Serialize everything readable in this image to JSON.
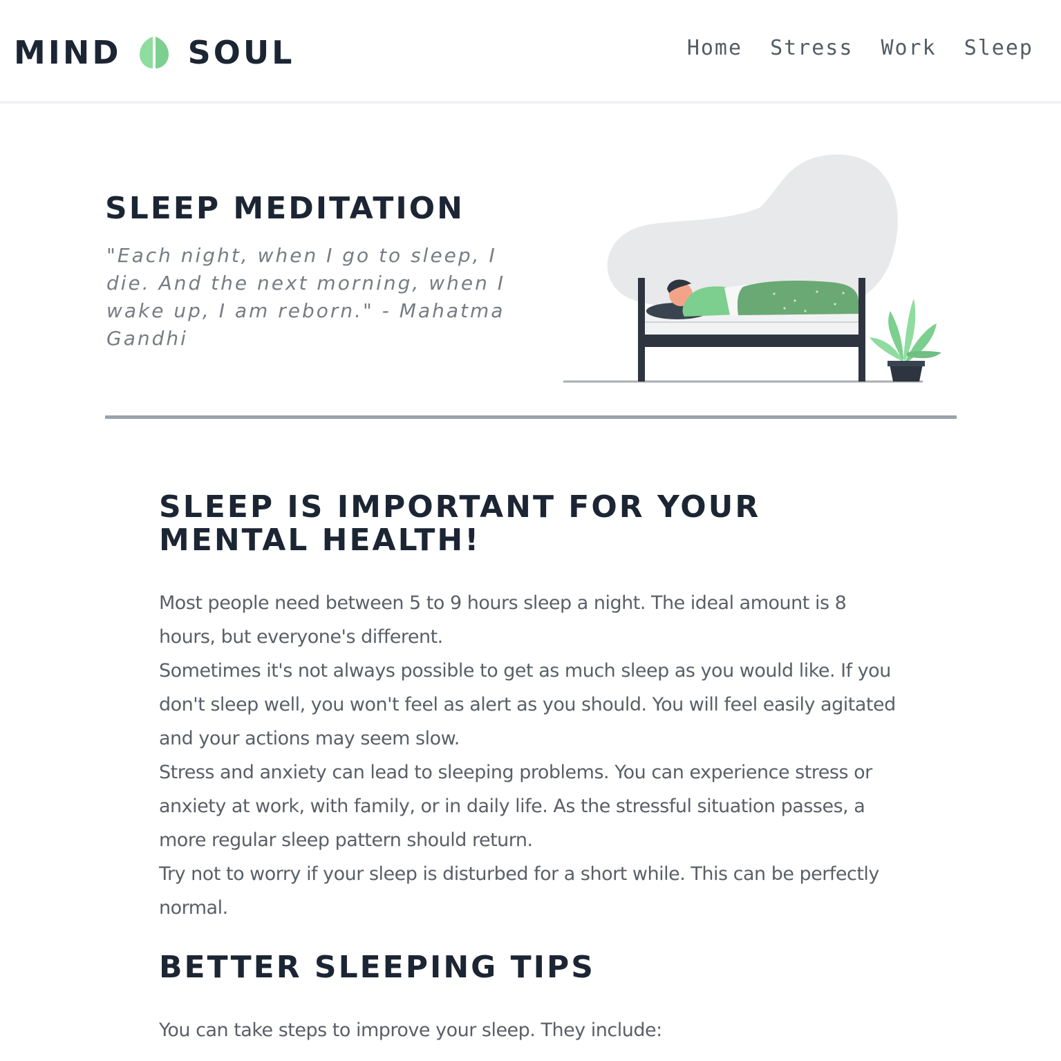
{
  "header": {
    "logo_left": "MIND",
    "logo_right": "SOUL",
    "logo_icon": "leaf-icon",
    "nav": [
      {
        "label": "Home"
      },
      {
        "label": "Stress"
      },
      {
        "label": "Work"
      },
      {
        "label": "Sleep"
      }
    ]
  },
  "hero": {
    "title": "SLEEP MEDITATION",
    "quote": "\"Each night, when I go to sleep, I die. And the next morning, when I wake up, I am reborn.\" - Mahatma Gandhi",
    "illustration": "sleeping-person-illustration"
  },
  "main": {
    "section_title": "SLEEP IS IMPORTANT FOR YOUR MENTAL HEALTH!",
    "paragraphs": [
      "Most people need between 5 to 9 hours sleep a night. The ideal amount is 8 hours, but everyone's different.",
      "Sometimes it's not always possible to get as much sleep as you would like. If you don't sleep well, you won't feel as alert as you should. You will feel easily agitated and your actions may seem slow.",
      "Stress and anxiety can lead to sleeping problems. You can experience stress or anxiety at work, with family, or in daily life. As the stressful situation passes, a more regular sleep pattern should return.",
      "Try not to worry if your sleep is disturbed for a short while. This can be perfectly normal."
    ],
    "tips_title": "BETTER SLEEPING TIPS",
    "tips_intro": "You can take steps to improve your sleep. They include:"
  },
  "colors": {
    "text_dark": "#1c2533",
    "body_text": "#5a5f66",
    "quote_text": "#777c83",
    "accent_green": "#7ccf8f",
    "blanket_green": "#6aa974",
    "divider": "#9aa3ad"
  }
}
